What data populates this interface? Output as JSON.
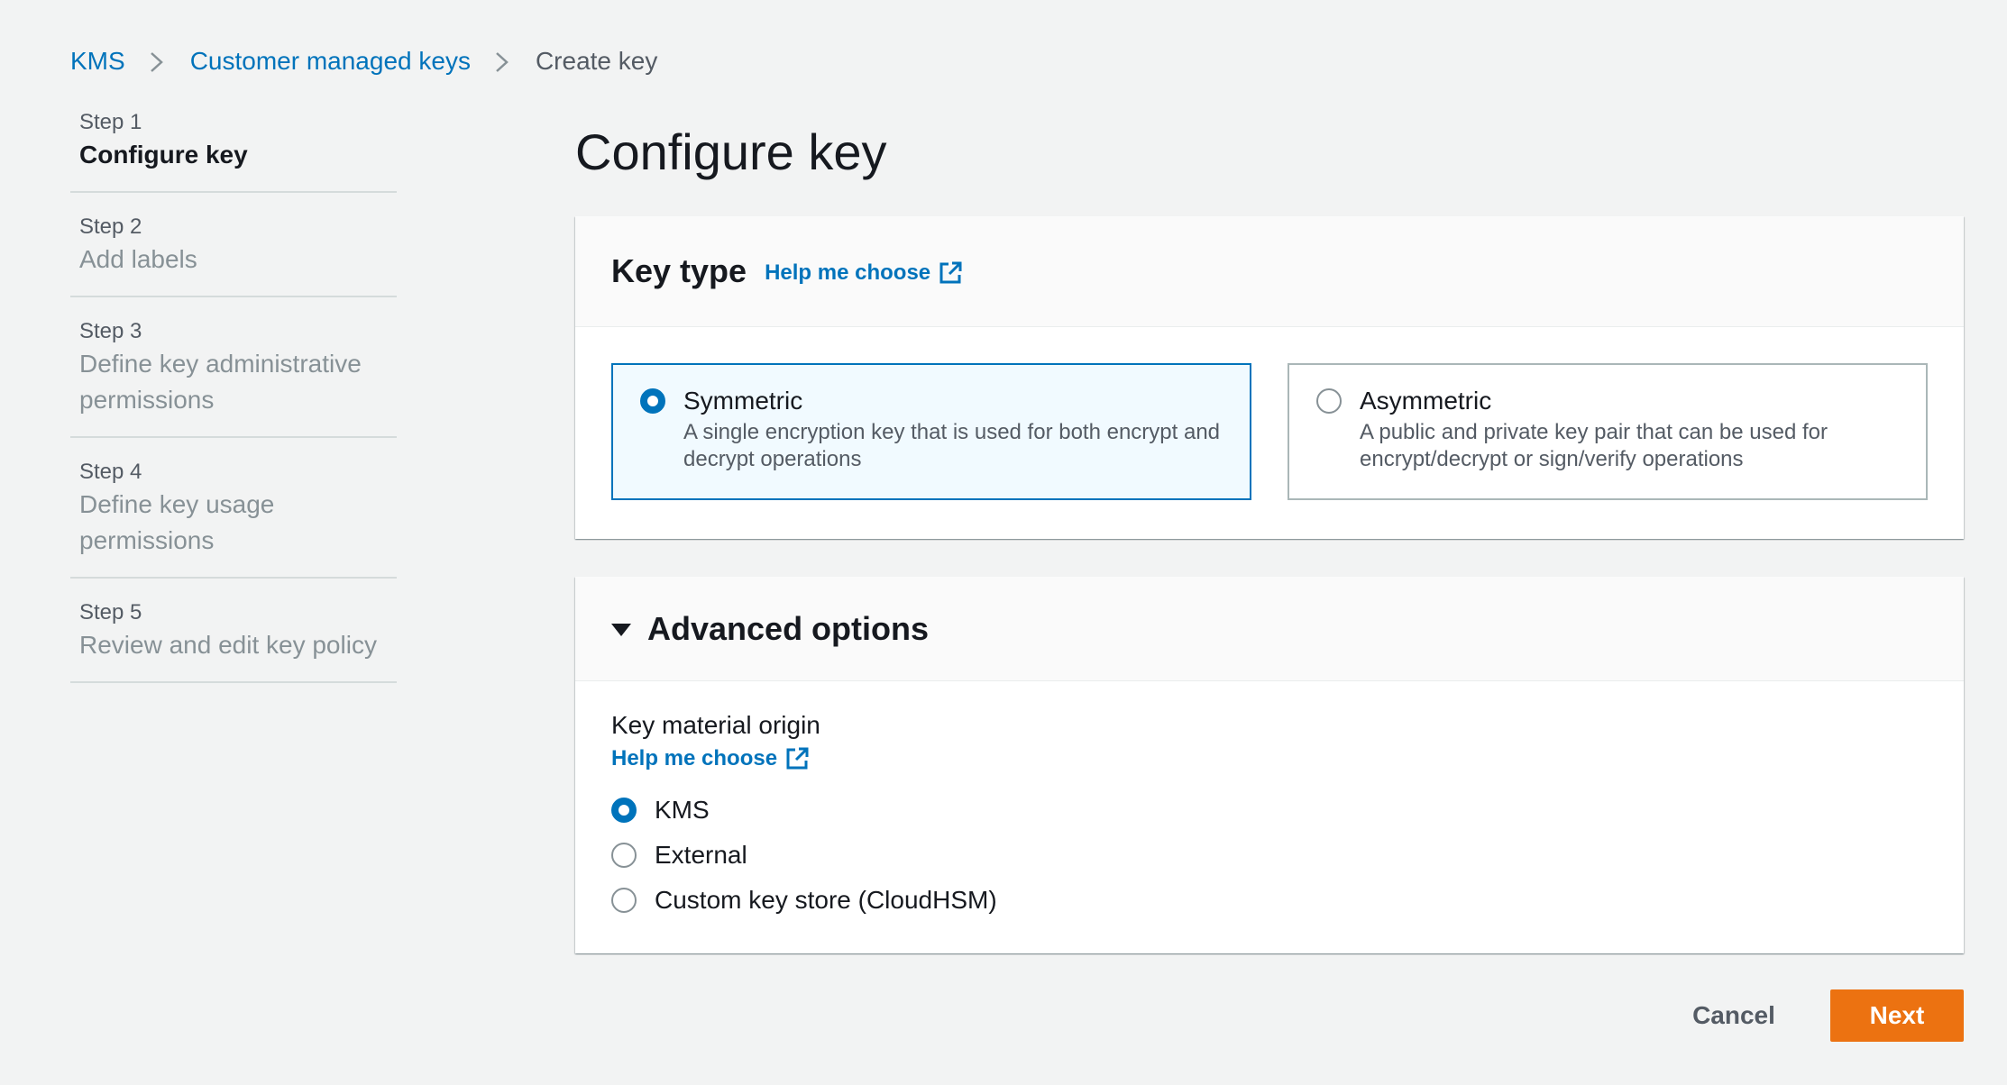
{
  "breadcrumb": {
    "items": [
      {
        "label": "KMS"
      },
      {
        "label": "Customer managed keys"
      },
      {
        "label": "Create key"
      }
    ]
  },
  "steps": [
    {
      "number": "Step 1",
      "label": "Configure key",
      "active": true
    },
    {
      "number": "Step 2",
      "label": "Add labels",
      "active": false
    },
    {
      "number": "Step 3",
      "label": "Define key administrative permissions",
      "active": false
    },
    {
      "number": "Step 4",
      "label": "Define key usage permissions",
      "active": false
    },
    {
      "number": "Step 5",
      "label": "Review and edit key policy",
      "active": false
    }
  ],
  "page_title": "Configure key",
  "key_type": {
    "title": "Key type",
    "help_link": "Help me choose",
    "options": [
      {
        "title": "Symmetric",
        "description": "A single encryption key that is used for both encrypt and decrypt operations",
        "selected": true
      },
      {
        "title": "Asymmetric",
        "description": "A public and private key pair that can be used for encrypt/decrypt or sign/verify operations",
        "selected": false
      }
    ]
  },
  "advanced": {
    "title": "Advanced options",
    "field_label": "Key material origin",
    "help_link": "Help me choose",
    "options": [
      {
        "label": "KMS",
        "selected": true
      },
      {
        "label": "External",
        "selected": false
      },
      {
        "label": "Custom key store (CloudHSM)",
        "selected": false
      }
    ]
  },
  "footer": {
    "cancel_label": "Cancel",
    "next_label": "Next"
  },
  "colors": {
    "link": "#0073bb",
    "primary_button": "#ec7211",
    "selected_tile_bg": "#f1faff"
  }
}
